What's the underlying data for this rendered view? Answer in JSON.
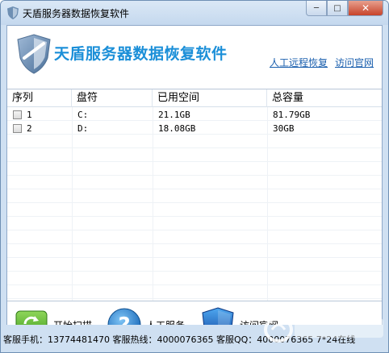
{
  "window": {
    "title": "天盾服务器数据恢复软件",
    "buttons": {
      "minimize": "─",
      "maximize": "□",
      "close": "✕"
    }
  },
  "header": {
    "app_title": "天盾服务器数据恢复软件",
    "link_remote": "人工远程恢复",
    "link_site": "访问官网"
  },
  "table": {
    "columns": [
      "序列",
      "盘符",
      "已用空间",
      "总容量"
    ],
    "rows": [
      {
        "seq": "1",
        "drive": "C:",
        "used": "21.1GB",
        "total": "81.79GB",
        "checked": false
      },
      {
        "seq": "2",
        "drive": "D:",
        "used": "18.08GB",
        "total": "30GB",
        "checked": false
      }
    ]
  },
  "actions": {
    "scan": "开始扫描",
    "service": "人工服务",
    "site": "访问官网"
  },
  "status": {
    "text": "客服手机：13774481470 客服热线：4000076365 客服QQ：4000076365 7*24在线"
  },
  "colors": {
    "title_blue": "#1b8fd8",
    "link_blue": "#1a5fae",
    "frame": "#cfe0f2"
  },
  "icons": {
    "title": "shield-icon",
    "banner": "shield-logo-icon",
    "scan": "refresh-icon",
    "service": "question-icon",
    "site": "shield-icon"
  }
}
